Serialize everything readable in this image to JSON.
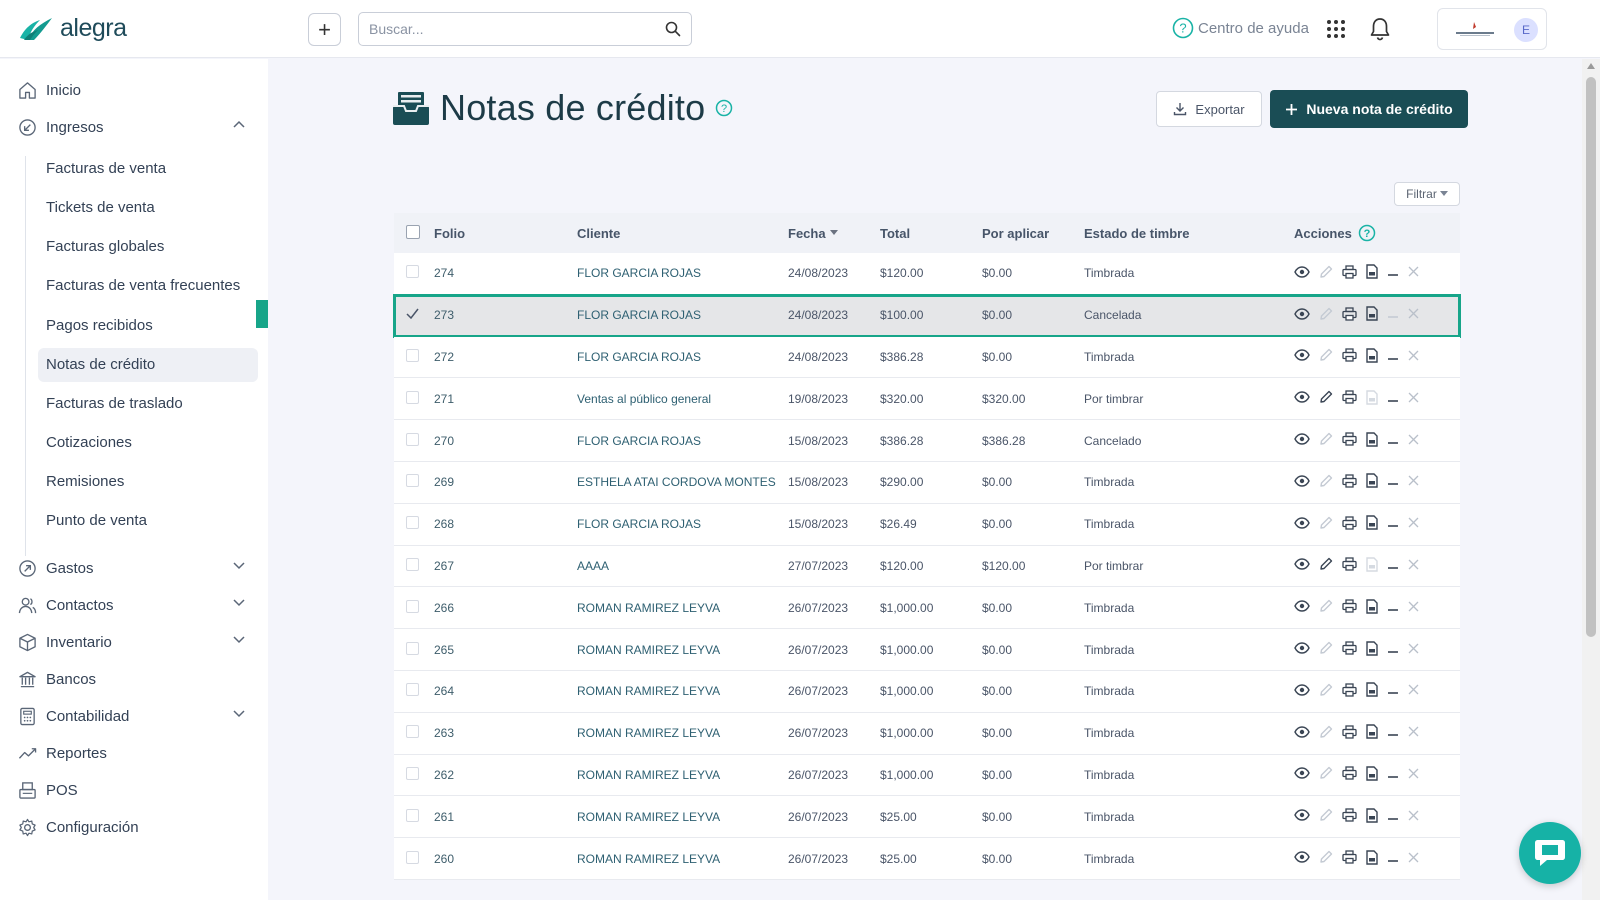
{
  "app": {
    "logo_text": "alegra"
  },
  "header": {
    "search_placeholder": "Buscar...",
    "help_label": "Centro de ayuda",
    "avatar_initial": "E"
  },
  "sidebar": {
    "items": [
      {
        "label": "Inicio",
        "icon": "home-icon"
      },
      {
        "label": "Ingresos",
        "icon": "income-icon",
        "expanded": true
      },
      {
        "label": "Gastos",
        "icon": "expenses-icon"
      },
      {
        "label": "Contactos",
        "icon": "contacts-icon"
      },
      {
        "label": "Inventario",
        "icon": "inventory-icon"
      },
      {
        "label": "Bancos",
        "icon": "bank-icon"
      },
      {
        "label": "Contabilidad",
        "icon": "accounting-icon"
      },
      {
        "label": "Reportes",
        "icon": "reports-icon"
      },
      {
        "label": "POS",
        "icon": "pos-icon"
      },
      {
        "label": "Configuración",
        "icon": "settings-icon"
      }
    ],
    "ingresos_sub": [
      "Facturas de venta",
      "Tickets de venta",
      "Facturas globales",
      "Facturas de venta frecuentes",
      "Pagos recibidos",
      "Notas de crédito",
      "Facturas de traslado",
      "Cotizaciones",
      "Remisiones",
      "Punto de venta"
    ],
    "active_sub": "Notas de crédito"
  },
  "main": {
    "title": "Notas de crédito",
    "export_label": "Exportar",
    "new_label": "Nueva nota de crédito",
    "filter_label": "Filtrar",
    "columns": {
      "folio": "Folio",
      "cliente": "Cliente",
      "fecha": "Fecha",
      "total": "Total",
      "por_aplicar": "Por aplicar",
      "estado": "Estado de timbre",
      "acciones": "Acciones"
    },
    "rows": [
      {
        "folio": "274",
        "cliente": "FLOR GARCIA ROJAS",
        "fecha": "24/08/2023",
        "total": "$120.00",
        "por_aplicar": "$0.00",
        "estado": "Timbrada"
      },
      {
        "folio": "273",
        "cliente": "FLOR GARCIA ROJAS",
        "fecha": "24/08/2023",
        "total": "$100.00",
        "por_aplicar": "$0.00",
        "estado": "Cancelada",
        "selected": true
      },
      {
        "folio": "272",
        "cliente": "FLOR GARCIA ROJAS",
        "fecha": "24/08/2023",
        "total": "$386.28",
        "por_aplicar": "$0.00",
        "estado": "Timbrada"
      },
      {
        "folio": "271",
        "cliente": "Ventas al público general",
        "fecha": "19/08/2023",
        "total": "$320.00",
        "por_aplicar": "$320.00",
        "estado": "Por timbrar"
      },
      {
        "folio": "270",
        "cliente": "FLOR GARCIA ROJAS",
        "fecha": "15/08/2023",
        "total": "$386.28",
        "por_aplicar": "$386.28",
        "estado": "Cancelado"
      },
      {
        "folio": "269",
        "cliente": "ESTHELA ATAI CORDOVA MONTES",
        "fecha": "15/08/2023",
        "total": "$290.00",
        "por_aplicar": "$0.00",
        "estado": "Timbrada"
      },
      {
        "folio": "268",
        "cliente": "FLOR GARCIA ROJAS",
        "fecha": "15/08/2023",
        "total": "$26.49",
        "por_aplicar": "$0.00",
        "estado": "Timbrada"
      },
      {
        "folio": "267",
        "cliente": "AAAA",
        "fecha": "27/07/2023",
        "total": "$120.00",
        "por_aplicar": "$120.00",
        "estado": "Por timbrar"
      },
      {
        "folio": "266",
        "cliente": "ROMAN RAMIREZ LEYVA",
        "fecha": "26/07/2023",
        "total": "$1,000.00",
        "por_aplicar": "$0.00",
        "estado": "Timbrada"
      },
      {
        "folio": "265",
        "cliente": "ROMAN RAMIREZ LEYVA",
        "fecha": "26/07/2023",
        "total": "$1,000.00",
        "por_aplicar": "$0.00",
        "estado": "Timbrada"
      },
      {
        "folio": "264",
        "cliente": "ROMAN RAMIREZ LEYVA",
        "fecha": "26/07/2023",
        "total": "$1,000.00",
        "por_aplicar": "$0.00",
        "estado": "Timbrada"
      },
      {
        "folio": "263",
        "cliente": "ROMAN RAMIREZ LEYVA",
        "fecha": "26/07/2023",
        "total": "$1,000.00",
        "por_aplicar": "$0.00",
        "estado": "Timbrada"
      },
      {
        "folio": "262",
        "cliente": "ROMAN RAMIREZ LEYVA",
        "fecha": "26/07/2023",
        "total": "$1,000.00",
        "por_aplicar": "$0.00",
        "estado": "Timbrada"
      },
      {
        "folio": "261",
        "cliente": "ROMAN RAMIREZ LEYVA",
        "fecha": "26/07/2023",
        "total": "$25.00",
        "por_aplicar": "$0.00",
        "estado": "Timbrada"
      },
      {
        "folio": "260",
        "cliente": "ROMAN RAMIREZ LEYVA",
        "fecha": "26/07/2023",
        "total": "$25.00",
        "por_aplicar": "$0.00",
        "estado": "Timbrada"
      }
    ]
  },
  "colors": {
    "brand": "#1a4d55",
    "accent": "#17a589",
    "logo": "#19b3a6"
  }
}
